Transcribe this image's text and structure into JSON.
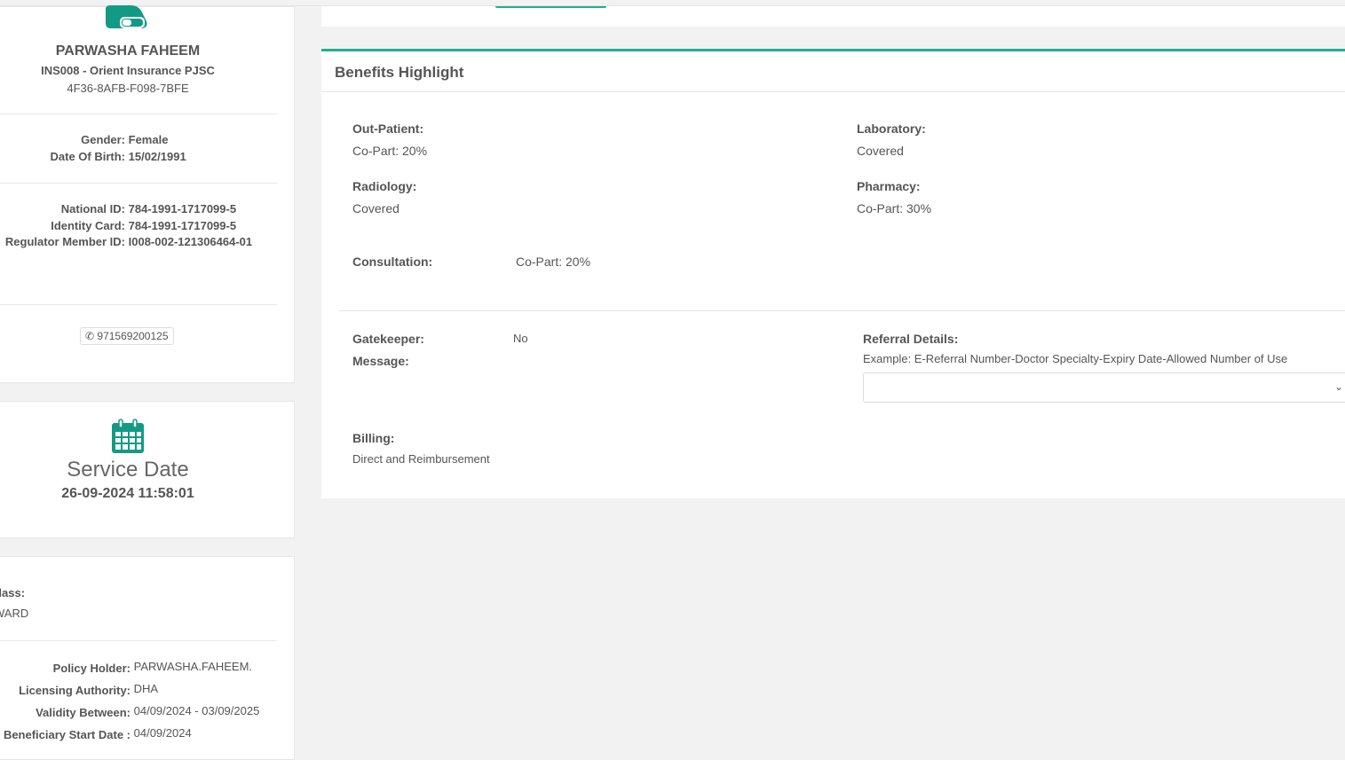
{
  "member": {
    "name": "PARWASHA FAHEEM",
    "insurer": "INS008 - Orient Insurance PJSC",
    "card_id": "4F36-8AFB-F098-7BFE",
    "gender_label": "Gender:",
    "gender": "Female",
    "dob_label": "Date Of Birth:",
    "dob": "15/02/1991",
    "national_id_label": "National ID:",
    "national_id": "784-1991-1717099-5",
    "identity_card_label": "Identity Card:",
    "identity_card": "784-1991-1717099-5",
    "regulator_label": "Regulator Member ID:",
    "regulator_id": "I008-002-121306464-01",
    "phone": "971569200125"
  },
  "service": {
    "title": "Service Date",
    "datetime": "26-09-2024 11:58:01"
  },
  "policy": {
    "class_label": "Class:",
    "class_value": "WARD",
    "holder_label": "Policy Holder:",
    "holder": "PARWASHA.FAHEEM.",
    "authority_label": "Licensing Authority:",
    "authority": "DHA",
    "validity_label": "Validity Between:",
    "validity": "04/09/2024 - 03/09/2025",
    "start_label": "Beneficiary Start Date :",
    "start": "04/09/2024"
  },
  "benefits": {
    "title": "Benefits Highlight",
    "outpatient_label": "Out-Patient:",
    "outpatient": "Co-Part: 20%",
    "laboratory_label": "Laboratory:",
    "laboratory": "Covered",
    "radiology_label": "Radiology:",
    "radiology": "Covered",
    "pharmacy_label": "Pharmacy:",
    "pharmacy": "Co-Part: 30%",
    "consultation_label": "Consultation:",
    "consultation": "Co-Part: 20%",
    "gatekeeper_label": "Gatekeeper:",
    "gatekeeper": "No",
    "message_label": "Message:",
    "referral_label": "Referral Details:",
    "referral_hint": "Example: E-Referral Number-Doctor Specialty-Expiry Date-Allowed Number of Use",
    "billing_label": "Billing:",
    "billing": "Direct and Reimbursement"
  },
  "colors": {
    "accent": "#1fae8f",
    "calendar": "#139a85"
  }
}
